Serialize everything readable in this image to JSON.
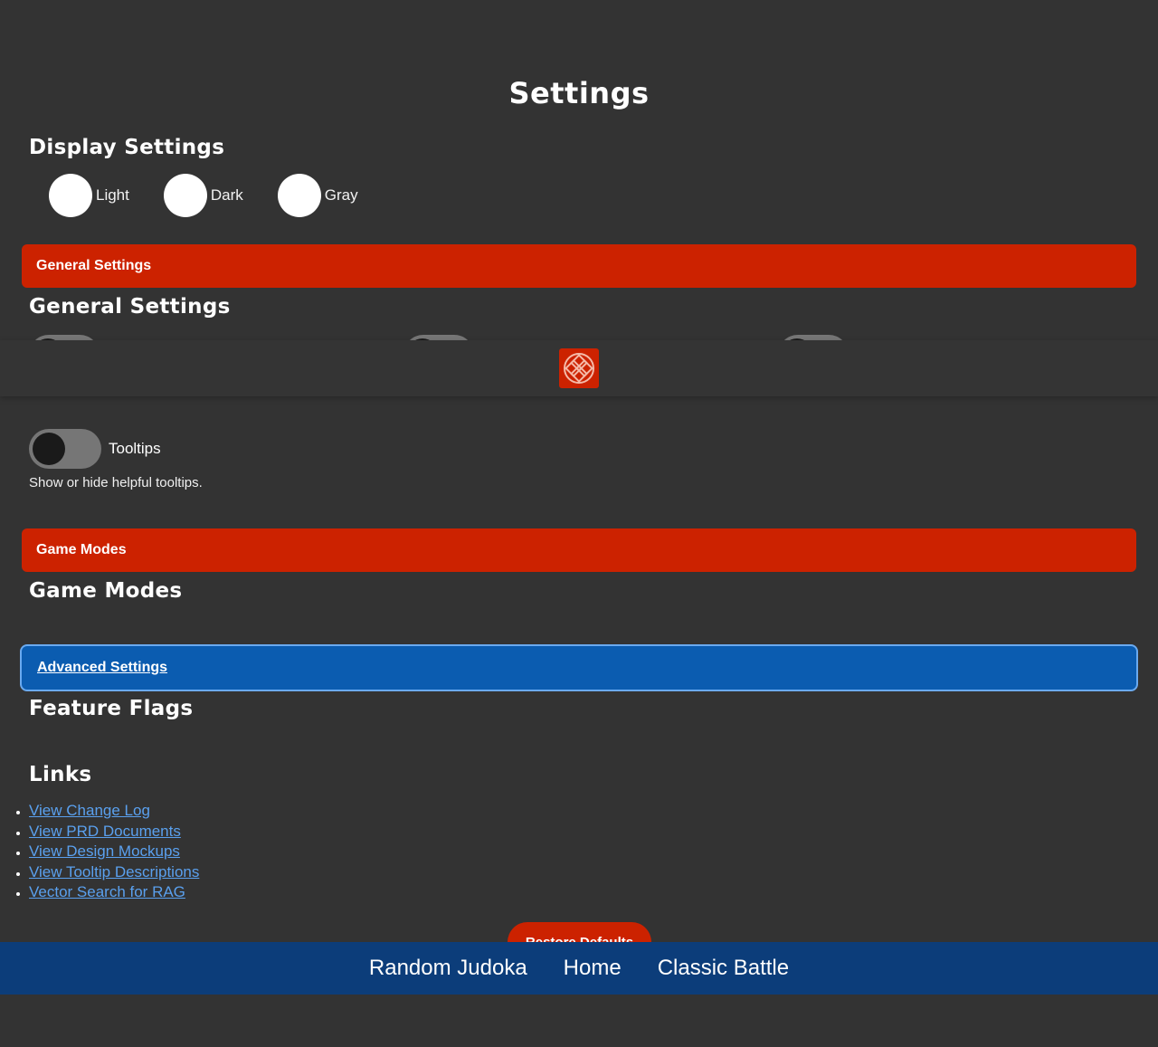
{
  "page": {
    "title": "Settings"
  },
  "display_settings": {
    "heading": "Display Settings",
    "options": [
      {
        "label": "Light"
      },
      {
        "label": "Dark"
      },
      {
        "label": "Gray"
      }
    ]
  },
  "general_section": {
    "bar_label": "General Settings",
    "heading": "General Settings",
    "tooltips": {
      "label": "Tooltips",
      "description": "Show or hide helpful tooltips.",
      "enabled": false
    }
  },
  "game_modes_section": {
    "bar_label": "Game Modes",
    "heading": "Game Modes"
  },
  "advanced_section": {
    "bar_label": "Advanced Settings",
    "heading": "Feature Flags"
  },
  "links_section": {
    "heading": "Links",
    "items": [
      {
        "label": "View Change Log"
      },
      {
        "label": "View PRD Documents"
      },
      {
        "label": "View Design Mockups"
      },
      {
        "label": "View Tooltip Descriptions"
      },
      {
        "label": "Vector Search for RAG"
      }
    ]
  },
  "restore_button": {
    "label": "Restore Defaults"
  },
  "bottom_nav": {
    "items": [
      {
        "label": "Random Judoka"
      },
      {
        "label": "Home"
      },
      {
        "label": "Classic Battle"
      }
    ]
  },
  "colors": {
    "background": "#333333",
    "accent_red": "#cc2200",
    "accent_blue": "#0b5cb0",
    "nav_blue": "#0c3d7a",
    "link_blue": "#5aa0ee"
  }
}
